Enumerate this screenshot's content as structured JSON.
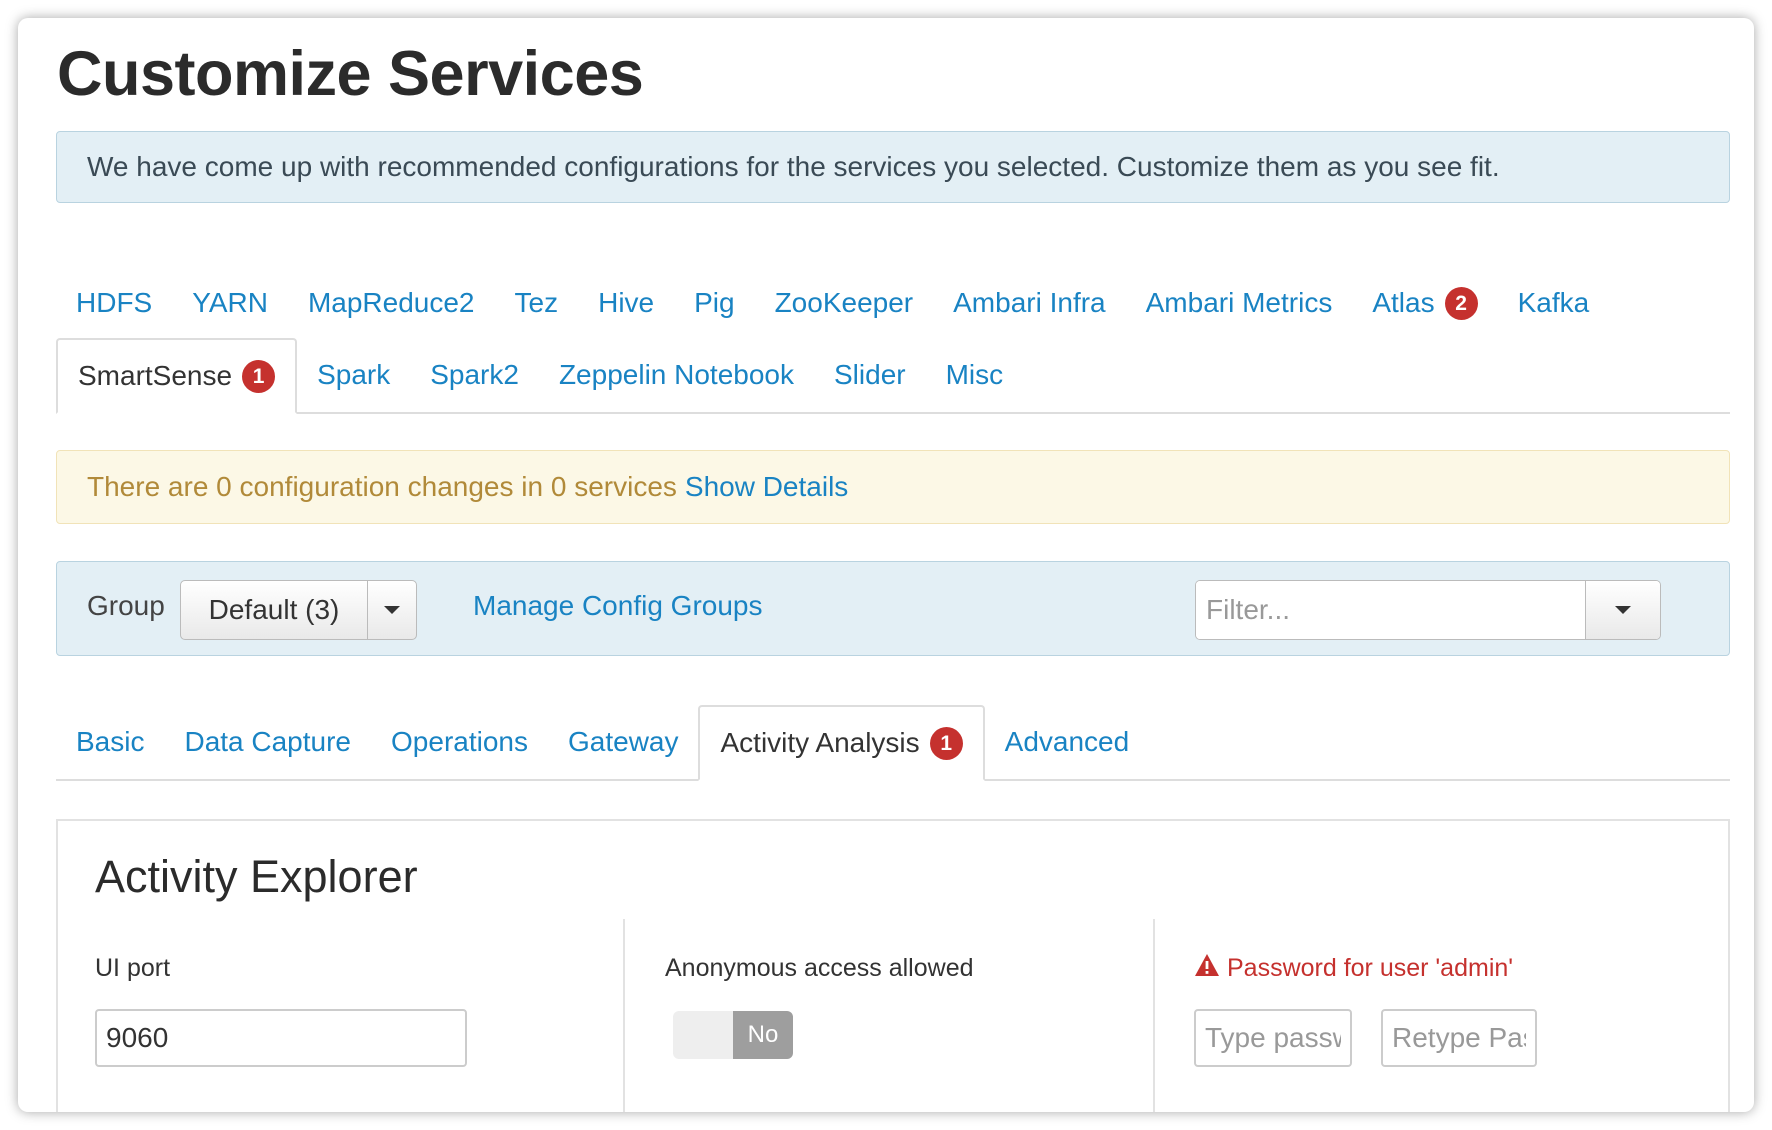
{
  "page": {
    "title": "Customize Services"
  },
  "info_alert": {
    "text": "We have come up with recommended configurations for the services you selected. Customize them as you see fit."
  },
  "service_tabs": {
    "row1": [
      {
        "label": "HDFS"
      },
      {
        "label": "YARN"
      },
      {
        "label": "MapReduce2"
      },
      {
        "label": "Tez"
      },
      {
        "label": "Hive"
      },
      {
        "label": "Pig"
      },
      {
        "label": "ZooKeeper"
      },
      {
        "label": "Ambari Infra"
      },
      {
        "label": "Ambari Metrics"
      },
      {
        "label": "Atlas",
        "badge": "2"
      },
      {
        "label": "Kafka"
      }
    ],
    "row2": [
      {
        "label": "SmartSense",
        "badge": "1",
        "active": true
      },
      {
        "label": "Spark"
      },
      {
        "label": "Spark2"
      },
      {
        "label": "Zeppelin Notebook"
      },
      {
        "label": "Slider"
      },
      {
        "label": "Misc"
      }
    ]
  },
  "changes_alert": {
    "text": "There are 0 configuration changes in 0 services",
    "link": "Show Details"
  },
  "group_bar": {
    "label": "Group",
    "selected": "Default (3)",
    "manage_link": "Manage Config Groups",
    "filter_placeholder": "Filter..."
  },
  "sub_tabs": [
    {
      "label": "Basic"
    },
    {
      "label": "Data Capture"
    },
    {
      "label": "Operations"
    },
    {
      "label": "Gateway"
    },
    {
      "label": "Activity Analysis",
      "badge": "1",
      "active": true
    },
    {
      "label": "Advanced"
    }
  ],
  "section": {
    "title": "Activity Explorer",
    "ui_port": {
      "label": "UI port",
      "value": "9060"
    },
    "anonymous": {
      "label": "Anonymous access allowed",
      "toggle_label": "No"
    },
    "password": {
      "label": "Password for user 'admin'",
      "placeholder": "Type password",
      "retype_placeholder": "Retype Password"
    }
  },
  "colors": {
    "link": "#1983c3",
    "badge": "#c5312e",
    "info_bg": "#e3eff5",
    "warning_bg": "#fcf8e6",
    "warning_text": "#b18a39",
    "error": "#c5312e"
  },
  "icons": {
    "error_label_icon": "warning-triangle-icon",
    "dropdown_icon": "caret-down-icon"
  }
}
